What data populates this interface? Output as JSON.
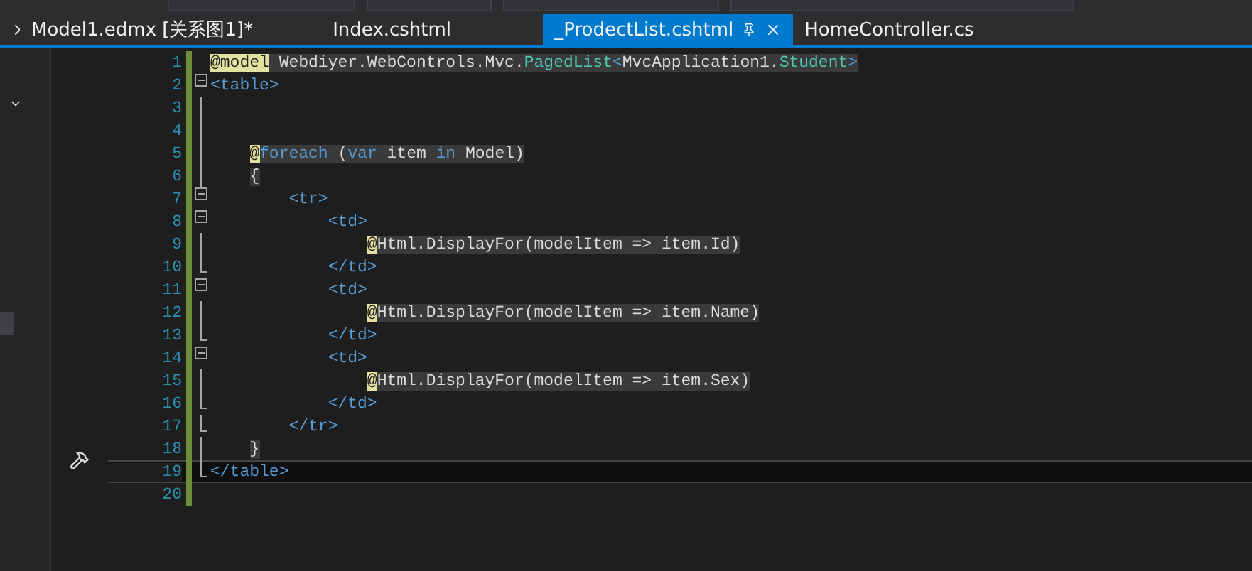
{
  "tabs": [
    {
      "label": "Model1.edmx [关系图1]*",
      "selected": false
    },
    {
      "label": "Index.cshtml",
      "selected": false
    },
    {
      "label": "_ProdectList.cshtml",
      "selected": true
    },
    {
      "label": "HomeController.cs",
      "selected": false
    }
  ],
  "editor": {
    "lines": [
      {
        "number": "1",
        "kind": "top",
        "block": true,
        "tokens": [
          {
            "kind": "razor",
            "text": "@model"
          },
          {
            "kind": "plain",
            "text": " Webdiyer.WebControls.Mvc."
          },
          {
            "kind": "type",
            "text": "PagedList"
          },
          {
            "kind": "tag",
            "text": "<"
          },
          {
            "kind": "plain",
            "text": "MvcApplication1."
          },
          {
            "kind": "type",
            "text": "Student"
          },
          {
            "kind": "tag",
            "text": ">"
          }
        ]
      },
      {
        "number": "2",
        "kind": "start",
        "block": false,
        "tokens": [
          {
            "kind": "tag",
            "text": "<table>"
          }
        ]
      },
      {
        "number": "3",
        "kind": "body"
      },
      {
        "number": "4",
        "kind": "body"
      },
      {
        "number": "5",
        "kind": "body",
        "block": true,
        "tokens": [
          {
            "kind": "razor",
            "text": "    @"
          },
          {
            "kind": "keyword",
            "text": "foreach"
          },
          {
            "kind": "plain",
            "text": " ("
          },
          {
            "kind": "keyword",
            "text": "var"
          },
          {
            "kind": "plain",
            "text": " item "
          },
          {
            "kind": "keyword",
            "text": "in"
          },
          {
            "kind": "plain",
            "text": " Model)"
          }
        ]
      },
      {
        "number": "6",
        "kind": "body",
        "block": true,
        "tokens": [
          {
            "kind": "plain",
            "text": "    {"
          }
        ]
      },
      {
        "number": "7",
        "kind": "start",
        "block": false,
        "tokens": [
          {
            "kind": "tag",
            "text": "        <tr>"
          }
        ]
      },
      {
        "number": "8",
        "kind": "start",
        "block": false,
        "tokens": [
          {
            "kind": "tag",
            "text": "            <td>"
          }
        ]
      },
      {
        "number": "9",
        "kind": "body",
        "block": true,
        "tokens": [
          {
            "kind": "razor",
            "text": "                @"
          },
          {
            "kind": "plain",
            "text": "Html.DisplayFor(modelItem => item.Id)"
          }
        ]
      },
      {
        "number": "10",
        "kind": "end",
        "block": false,
        "tokens": [
          {
            "kind": "tag",
            "text": "            </td>"
          }
        ]
      },
      {
        "number": "11",
        "kind": "start",
        "block": false,
        "tokens": [
          {
            "kind": "tag",
            "text": "            <td>"
          }
        ]
      },
      {
        "number": "12",
        "kind": "body",
        "block": true,
        "tokens": [
          {
            "kind": "razor",
            "text": "                @"
          },
          {
            "kind": "plain",
            "text": "Html.DisplayFor(modelItem => item.Name)"
          }
        ]
      },
      {
        "number": "13",
        "kind": "end",
        "block": false,
        "tokens": [
          {
            "kind": "tag",
            "text": "            </td>"
          }
        ]
      },
      {
        "number": "14",
        "kind": "start",
        "block": false,
        "tokens": [
          {
            "kind": "tag",
            "text": "            <td>"
          }
        ]
      },
      {
        "number": "15",
        "kind": "body",
        "block": true,
        "tokens": [
          {
            "kind": "razor",
            "text": "                @"
          },
          {
            "kind": "plain",
            "text": "Html.DisplayFor(modelItem => item.Sex)"
          }
        ]
      },
      {
        "number": "16",
        "kind": "end",
        "block": false,
        "tokens": [
          {
            "kind": "tag",
            "text": "            </td>"
          }
        ]
      },
      {
        "number": "17",
        "kind": "end",
        "block": false,
        "tokens": [
          {
            "kind": "tag",
            "text": "        </tr>"
          }
        ]
      },
      {
        "number": "18",
        "kind": "body",
        "block": true,
        "tokens": [
          {
            "kind": "plain",
            "text": "    }"
          }
        ]
      },
      {
        "number": "19",
        "kind": "end",
        "block": false,
        "current": true,
        "tokens": [
          {
            "kind": "tag",
            "text": "</table>"
          }
        ]
      },
      {
        "number": "20",
        "kind": "top"
      }
    ]
  }
}
